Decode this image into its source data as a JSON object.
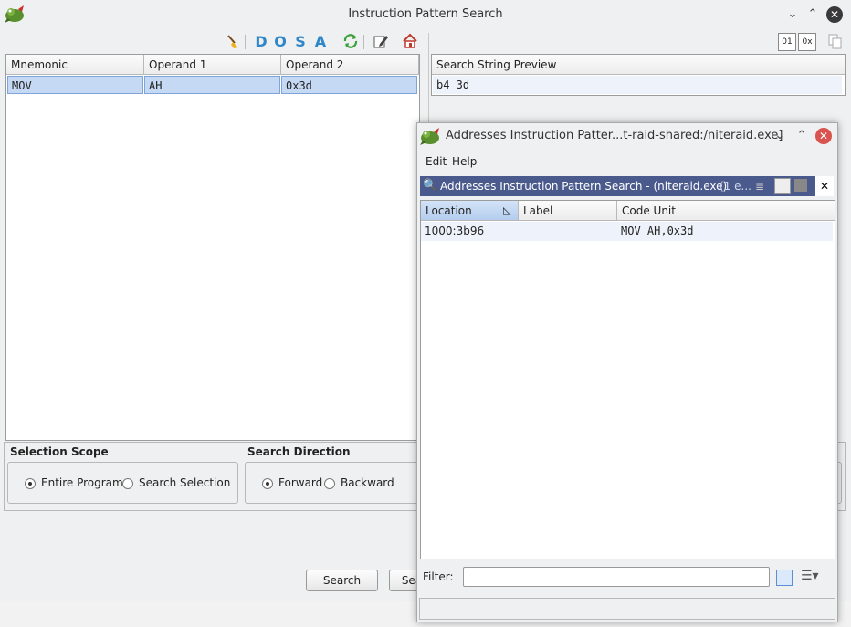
{
  "main_window": {
    "title": "Instruction Pattern Search",
    "toolbar": {
      "dosa": [
        "D",
        "O",
        "S",
        "A"
      ]
    },
    "pattern_table": {
      "columns": [
        "Mnemonic",
        "Operand 1",
        "Operand 2"
      ],
      "rows": [
        [
          "MOV",
          "AH",
          "0x3d"
        ]
      ]
    },
    "preview": {
      "header": "Search String Preview",
      "value": "b4 3d"
    },
    "selection_scope": {
      "title": "Selection Scope",
      "options": [
        "Entire Program",
        "Search Selection"
      ],
      "selected": "Entire Program"
    },
    "search_direction": {
      "title": "Search Direction",
      "options": [
        "Forward",
        "Backward"
      ],
      "selected": "Forward"
    },
    "buttons": {
      "search": "Search",
      "search_all_partial": "Sea"
    }
  },
  "results_window": {
    "title": "Addresses Instruction Patter...t-raid-shared:/niteraid.exe]",
    "menu": [
      "Edit",
      "Help"
    ],
    "results_bar_title": "Addresses Instruction Pattern Search - (niteraid.exe)",
    "results_bar_count": "(1 e...",
    "table": {
      "columns": [
        "Location",
        "Label",
        "Code Unit"
      ],
      "rows": [
        [
          "1000:3b96",
          "",
          "MOV AH,0x3d"
        ]
      ]
    },
    "filter_label": "Filter:",
    "filter_value": ""
  },
  "colors": {
    "selection_row": "#c5d9f5",
    "results_title_bar": "#4a5a8c",
    "dosa_blue": "#2f86c9",
    "close_red": "#d9534f"
  }
}
